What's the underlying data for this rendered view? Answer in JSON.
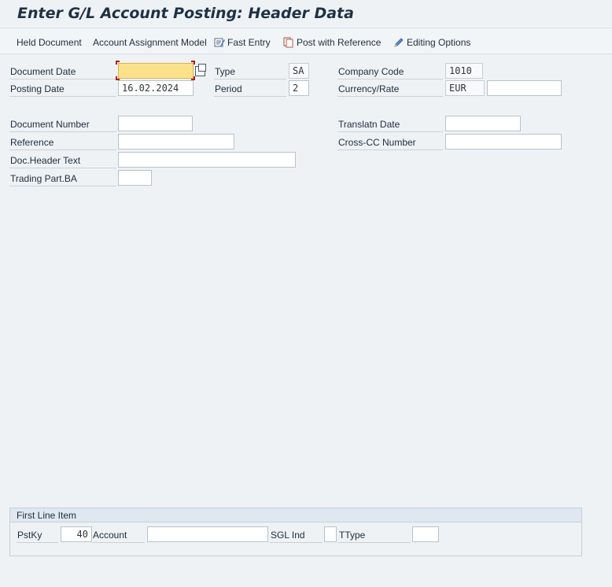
{
  "window": {
    "title": "Enter G/L Account Posting: Header Data"
  },
  "toolbar": {
    "held_document": "Held Document",
    "account_assignment_model": "Account Assignment Model",
    "fast_entry": "Fast Entry",
    "post_with_reference": "Post with Reference",
    "editing_options": "Editing Options"
  },
  "header": {
    "document_date": {
      "label": "Document Date",
      "value": ""
    },
    "posting_date": {
      "label": "Posting Date",
      "value": "16.02.2024"
    },
    "type": {
      "label": "Type",
      "value": "SA"
    },
    "period": {
      "label": "Period",
      "value": "2"
    },
    "company_code": {
      "label": "Company Code",
      "value": "1010"
    },
    "currency_rate": {
      "label": "Currency/Rate",
      "currency": "EUR",
      "rate": ""
    },
    "document_number": {
      "label": "Document Number",
      "value": ""
    },
    "translatn_date": {
      "label": "Translatn Date",
      "value": ""
    },
    "reference": {
      "label": "Reference",
      "value": ""
    },
    "cross_cc_number": {
      "label": "Cross-CC Number",
      "value": ""
    },
    "doc_header_text": {
      "label": "Doc.Header Text",
      "value": ""
    },
    "trading_part_ba": {
      "label": "Trading Part.BA",
      "value": ""
    }
  },
  "first_line_item": {
    "title": "First Line Item",
    "pstky": {
      "label": "PstKy",
      "value": "40"
    },
    "account": {
      "label": "Account",
      "value": ""
    },
    "sgl_ind": {
      "label": "SGL Ind",
      "value": ""
    },
    "ttype": {
      "label": "TType",
      "value": ""
    }
  },
  "colors": {
    "background": "#eef2f5",
    "active_field": "#fbe28a",
    "focus_corner": "#b31b1b",
    "group_header": "#dfe8f0"
  }
}
